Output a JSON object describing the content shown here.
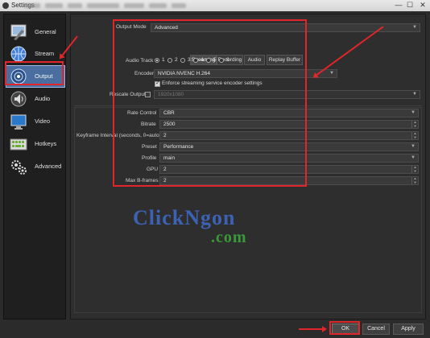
{
  "window": {
    "title": "Settings",
    "min": "—",
    "max": "☐",
    "close": "✕"
  },
  "sidebar": {
    "items": [
      {
        "label": "General",
        "icon": "wrench-icon"
      },
      {
        "label": "Stream",
        "icon": "globe-icon"
      },
      {
        "label": "Output",
        "icon": "signal-icon",
        "selected": true
      },
      {
        "label": "Audio",
        "icon": "speaker-icon"
      },
      {
        "label": "Video",
        "icon": "monitor-icon"
      },
      {
        "label": "Hotkeys",
        "icon": "keyboard-icon"
      },
      {
        "label": "Advanced",
        "icon": "gears-icon"
      }
    ]
  },
  "output": {
    "mode_label": "Output Mode",
    "mode_value": "Advanced",
    "tabs": [
      "Streaming",
      "Recording",
      "Audio",
      "Replay Buffer"
    ],
    "active_tab": "Streaming",
    "audio_track_label": "Audio Track",
    "audio_tracks": [
      "1",
      "2",
      "3",
      "4",
      "5",
      "6"
    ],
    "audio_track_selected": "1",
    "encoder_label": "Encoder",
    "encoder_value": "NVIDIA NVENC H.264",
    "enforce_label": "Enforce streaming service encoder settings",
    "enforce_checked": true,
    "rescale_label": "Rescale Output",
    "rescale_value": "1920x1080",
    "rescale_checked": false
  },
  "encoder_settings": {
    "rate_control_label": "Rate Control",
    "rate_control_value": "CBR",
    "bitrate_label": "Bitrate",
    "bitrate_value": "2500",
    "keyframe_label": "Keyframe Interval (seconds, 0=auto)",
    "keyframe_value": "2",
    "preset_label": "Preset",
    "preset_value": "Performance",
    "profile_label": "Profile",
    "profile_value": "main",
    "gpu_label": "GPU",
    "gpu_value": "2",
    "bframes_label": "Max B-frames",
    "bframes_value": "2"
  },
  "watermark": {
    "line1": "ClickNgon",
    "line2": ".com"
  },
  "footer": {
    "ok": "OK",
    "cancel": "Cancel",
    "apply": "Apply"
  },
  "colors": {
    "highlight": "#e0262b",
    "selected": "#4a6ea0",
    "watermark_blue": "#3d62b3",
    "watermark_green": "#3a9a3a"
  }
}
